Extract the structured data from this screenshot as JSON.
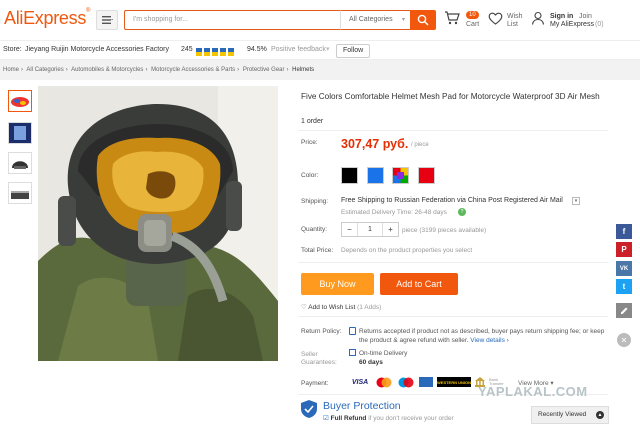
{
  "header": {
    "logo": "AliExpress",
    "logo_mark": "®",
    "search_placeholder": "I'm shopping for...",
    "search_category": "All Categories",
    "cart_count": "10",
    "cart_label": "Cart",
    "wish_label_1": "Wish",
    "wish_label_2": "List",
    "signin": "Sign in",
    "join": "Join",
    "my_ali": "My AliExpress",
    "my_ali_count": "(0)"
  },
  "store": {
    "prefix": "Store:",
    "name": "Jieyang Ruijin Motorcycle Accessories Factory",
    "score": "245",
    "feedback_pct": "94.5%",
    "feedback_label": "Positive feedback",
    "follow": "Follow"
  },
  "breadcrumb": [
    "Home",
    "All Categories",
    "Automobiles & Motorcycles",
    "Motorcycle Accessories & Parts",
    "Protective Gear",
    "Helmets"
  ],
  "product": {
    "title": "Five Colors Comfortable Helmet Mesh Pad for Motorcycle Waterproof 3D Air Mesh",
    "orders": "1 order",
    "price_label": "Price:",
    "price": "307,47 руб.",
    "per": "/ piece",
    "color_label": "Color:",
    "colors": [
      "#000000",
      "#1a73e8",
      "multi",
      "#e60012"
    ],
    "shipping_label": "Shipping:",
    "shipping": "Free Shipping to Russian Federation via China Post Registered Air Mail",
    "delivery": "Estimated Delivery Time: 26-48 days",
    "quantity_label": "Quantity:",
    "quantity": "1",
    "qty_minus": "−",
    "qty_plus": "+",
    "qty_note": "piece (3199 pieces available)",
    "total_label": "Total Price:",
    "total_note": "Depends on the product properties you select",
    "buy_now": "Buy Now",
    "add_to_cart": "Add to Cart",
    "wish": "Add to Wish List",
    "wish_count": "(1 Adds)",
    "return_label": "Return Policy:",
    "return_text": "Returns accepted if product not as described, buyer pays return shipping fee; or keep the product & agree refund with seller.",
    "return_link": "View details",
    "seller_label_1": "Seller",
    "seller_label_2": "Guarantees:",
    "ontime": "On-time Delivery",
    "ontime_days": "60 days",
    "payment_label": "Payment:",
    "pay_visa": "VISA",
    "pay_wu": "WESTERN UNION",
    "bank": "Bank Transfer",
    "view_more": "View More",
    "bp_title": "Buyer Protection",
    "bp_full": "Full Refund",
    "bp_rest": "if you don't receive your order"
  },
  "watermark": "YAPLAKAL.COM",
  "recently_viewed": "Recently Viewed",
  "share_icons": [
    "f",
    "P",
    "VK",
    "t"
  ]
}
